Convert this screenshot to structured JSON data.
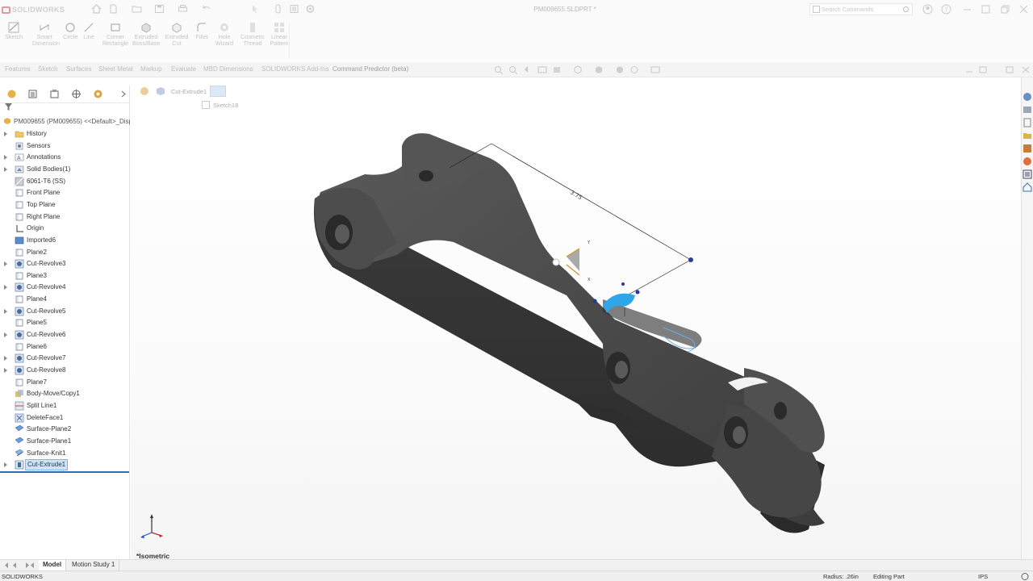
{
  "app": {
    "brand": "SOLIDWORKS",
    "document_title": "PM009655.SLDPRT *"
  },
  "search": {
    "placeholder": "Search Commands"
  },
  "command_manager": [
    {
      "label": "Sketch",
      "icon": "sketch-icon"
    },
    {
      "label": "Smart\nDimension",
      "icon": "smart-dimension-icon"
    },
    {
      "label": "Circle",
      "icon": "circle-icon"
    },
    {
      "label": "Line",
      "icon": "line-icon"
    },
    {
      "label": "Corner\nRectangle",
      "icon": "rectangle-icon"
    },
    {
      "label": "Extruded\nBoss/Base",
      "icon": "extruded-boss-icon"
    },
    {
      "label": "Extruded\nCut",
      "icon": "extruded-cut-icon"
    },
    {
      "label": "Fillet",
      "icon": "fillet-icon"
    },
    {
      "label": "Hole\nWizard",
      "icon": "hole-wizard-icon"
    },
    {
      "label": "Cosmetic\nThread",
      "icon": "cosmetic-thread-icon"
    },
    {
      "label": "Linear\nPattern",
      "icon": "linear-pattern-icon"
    }
  ],
  "tabs": [
    "Features",
    "Sketch",
    "Surfaces",
    "Sheet Metal",
    "Markup",
    "Evaluate",
    "MBD Dimensions",
    "SOLIDWORKS Add-Ins",
    "Command Predictor (beta)"
  ],
  "feature_tree": {
    "root": "PM009655 (PM009655) <<Default>_Disp",
    "items": [
      {
        "label": "History",
        "icon": "history-folder-icon",
        "expandable": true
      },
      {
        "label": "Sensors",
        "icon": "sensor-icon",
        "expandable": false
      },
      {
        "label": "Annotations",
        "icon": "annotations-icon",
        "expandable": true
      },
      {
        "label": "Solid Bodies(1)",
        "icon": "solid-bodies-icon",
        "expandable": true
      },
      {
        "label": "6061-T6 (SS)",
        "icon": "material-icon",
        "expandable": false
      },
      {
        "label": "Front Plane",
        "icon": "plane-icon",
        "expandable": false
      },
      {
        "label": "Top Plane",
        "icon": "plane-icon",
        "expandable": false
      },
      {
        "label": "Right Plane",
        "icon": "plane-icon",
        "expandable": false
      },
      {
        "label": "Origin",
        "icon": "origin-icon",
        "expandable": false
      },
      {
        "label": "Imported6",
        "icon": "imported-body-icon",
        "expandable": false
      },
      {
        "label": "Plane2",
        "icon": "plane-icon",
        "expandable": false
      },
      {
        "label": "Cut-Revolve3",
        "icon": "cut-revolve-icon",
        "expandable": true
      },
      {
        "label": "Plane3",
        "icon": "plane-icon",
        "expandable": false
      },
      {
        "label": "Cut-Revolve4",
        "icon": "cut-revolve-icon",
        "expandable": true
      },
      {
        "label": "Plane4",
        "icon": "plane-icon",
        "expandable": false
      },
      {
        "label": "Cut-Revolve5",
        "icon": "cut-revolve-icon",
        "expandable": true
      },
      {
        "label": "Plane5",
        "icon": "plane-icon",
        "expandable": false
      },
      {
        "label": "Cut-Revolve6",
        "icon": "cut-revolve-icon",
        "expandable": true
      },
      {
        "label": "Plane6",
        "icon": "plane-icon",
        "expandable": false
      },
      {
        "label": "Cut-Revolve7",
        "icon": "cut-revolve-icon",
        "expandable": true
      },
      {
        "label": "Cut-Revolve8",
        "icon": "cut-revolve-icon",
        "expandable": true
      },
      {
        "label": "Plane7",
        "icon": "plane-icon",
        "expandable": false
      },
      {
        "label": "Body-Move/Copy1",
        "icon": "move-copy-icon",
        "expandable": false
      },
      {
        "label": "Split Line1",
        "icon": "split-line-icon",
        "expandable": false
      },
      {
        "label": "DeleteFace1",
        "icon": "delete-face-icon",
        "expandable": false
      },
      {
        "label": "Surface-Plane2",
        "icon": "surface-plane-icon",
        "expandable": false
      },
      {
        "label": "Surface-Plane1",
        "icon": "surface-plane-icon",
        "expandable": false
      },
      {
        "label": "Surface-Knit1",
        "icon": "surface-knit-icon",
        "expandable": false
      },
      {
        "label": "Cut-Extrude1",
        "icon": "cut-extrude-icon",
        "expandable": true,
        "selected": true
      }
    ]
  },
  "viewport": {
    "breadcrumb": "Cut-Extrude1",
    "sketch_crumb": "Sketch18",
    "dimension_text": "3.75",
    "view_label": "*Isometric"
  },
  "bottom_tabs": [
    "Model",
    "Motion Study 1"
  ],
  "status": {
    "app": "SOLIDWORKS",
    "radius": "Radius: .26in",
    "mode": "Editing Part",
    "units": "IPS"
  },
  "colors": {
    "part": "#4a4a4a",
    "selection_blue": "#2fa6e8",
    "rollback_bar": "#2f6fb3",
    "brand_red": "#c0282d"
  }
}
